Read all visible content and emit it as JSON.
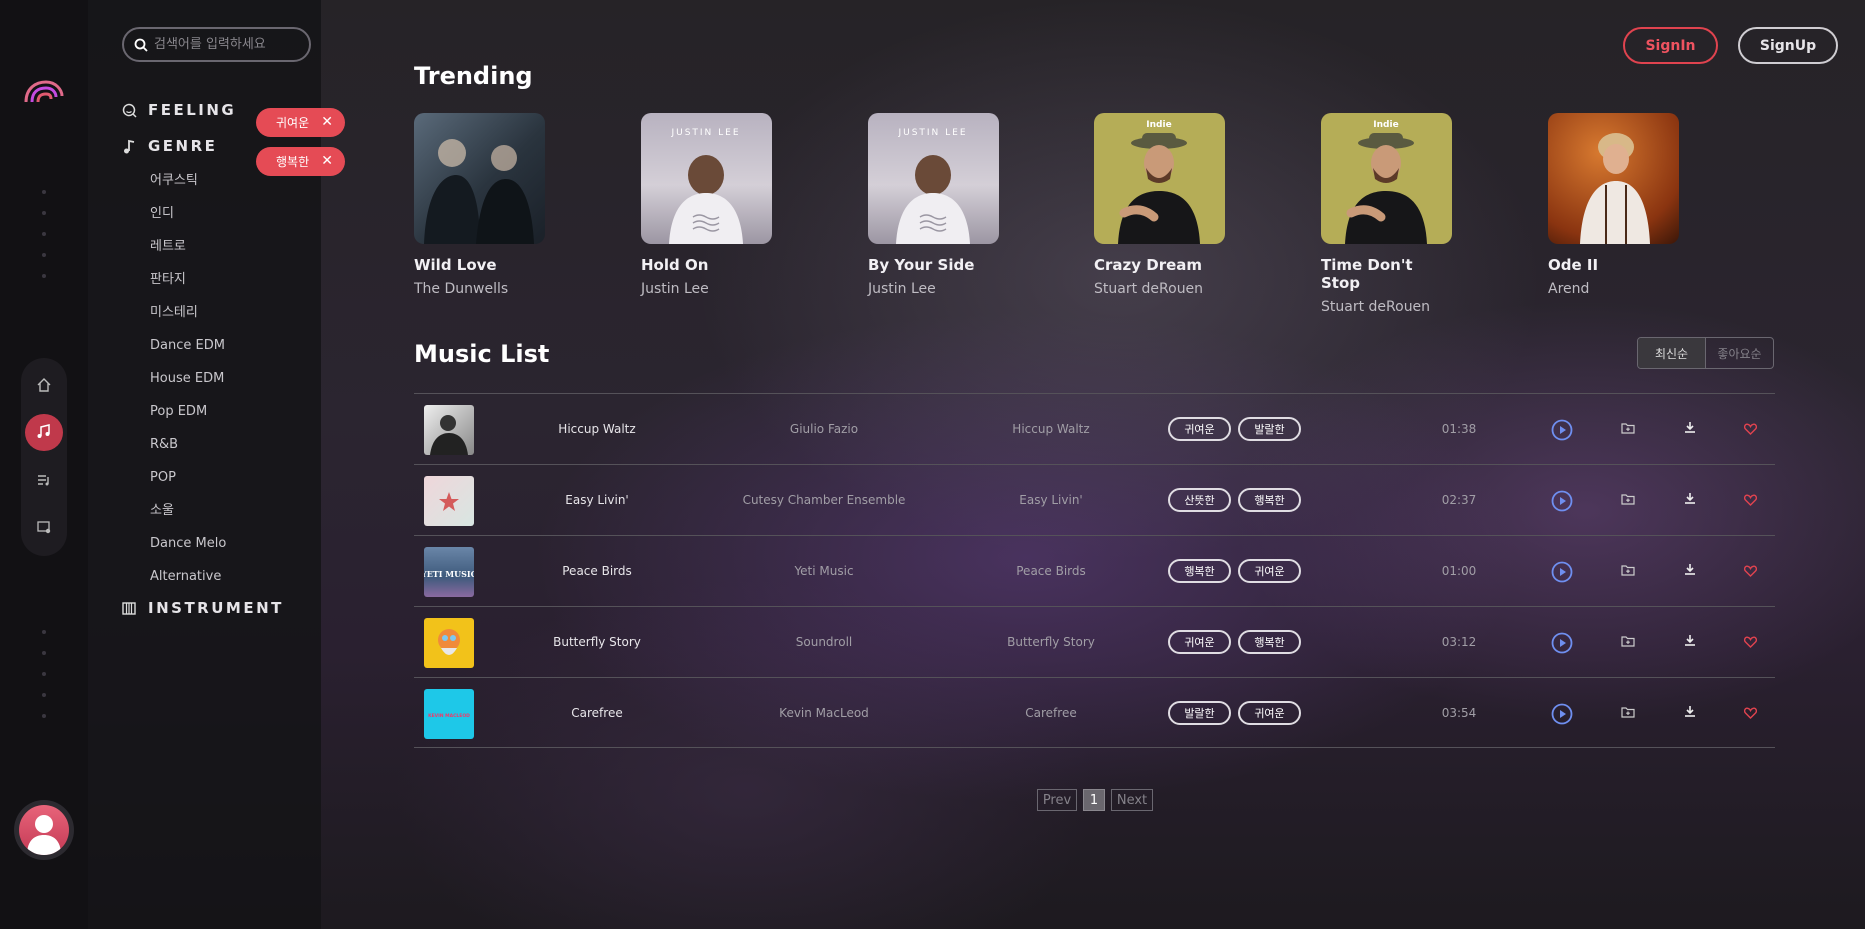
{
  "search": {
    "placeholder": "검색어를 입력하세요"
  },
  "categories": {
    "feeling": "FEELING",
    "genre": "GENRE",
    "instrument": "INSTRUMENT"
  },
  "genres": [
    "어쿠스틱",
    "인디",
    "레트로",
    "판타지",
    "미스테리",
    "Dance EDM",
    "House EDM",
    "Pop EDM",
    "R&B",
    "POP",
    "소울",
    "Dance Melo",
    "Alternative"
  ],
  "chips": [
    "귀여운",
    "행복한"
  ],
  "header": {
    "signin": "SignIn",
    "signup": "SignUp"
  },
  "trending": {
    "title": "Trending",
    "items": [
      {
        "name": "Wild Love",
        "artist": "The Dunwells"
      },
      {
        "name": "Hold On",
        "artist": "Justin Lee"
      },
      {
        "name": "By Your Side",
        "artist": "Justin Lee"
      },
      {
        "name": "Crazy Dream",
        "artist": "Stuart deRouen"
      },
      {
        "name": "Time Don't Stop",
        "artist": "Stuart deRouen"
      },
      {
        "name": "Ode II",
        "artist": "Arend"
      }
    ],
    "cover_labels": {
      "justin": "JUSTIN LEE",
      "indie": "Indie"
    }
  },
  "music_list": {
    "title": "Music List",
    "sort": {
      "latest": "최신순",
      "popular": "좋아요순"
    },
    "rows": [
      {
        "title": "Hiccup Waltz",
        "artist": "Giulio Fazio",
        "album": "Hiccup Waltz",
        "tags": [
          "귀여운",
          "발랄한"
        ],
        "time": "01:38"
      },
      {
        "title": "Easy Livin'",
        "artist": "Cutesy Chamber Ensemble",
        "album": "Easy Livin'",
        "tags": [
          "산뜻한",
          "행복한"
        ],
        "time": "02:37"
      },
      {
        "title": "Peace Birds",
        "artist": "Yeti Music",
        "album": "Peace Birds",
        "tags": [
          "행복한",
          "귀여운"
        ],
        "time": "01:00"
      },
      {
        "title": "Butterfly Story",
        "artist": "Soundroll",
        "album": "Butterfly Story",
        "tags": [
          "귀여운",
          "행복한"
        ],
        "time": "03:12"
      },
      {
        "title": "Carefree",
        "artist": "Kevin MacLeod",
        "album": "Carefree",
        "tags": [
          "발랄한",
          "귀여운"
        ],
        "time": "03:54"
      }
    ],
    "thumb_labels": {
      "yeti": "YETI MUSIC",
      "kevin": "KEVIN MACLEOD"
    }
  },
  "pager": {
    "prev": "Prev",
    "current": "1",
    "next": "Next"
  },
  "colors": {
    "accent": "#e54b55",
    "play": "#6f8ff0",
    "heart": "#e0434f"
  }
}
